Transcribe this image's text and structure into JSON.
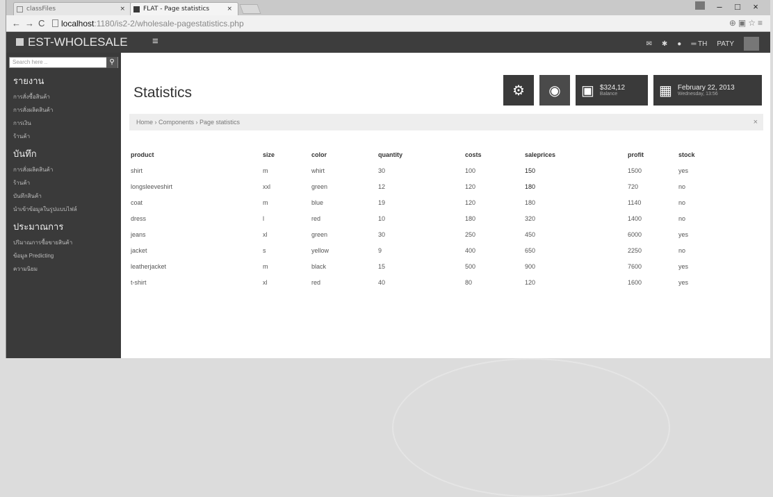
{
  "browser": {
    "tabs": [
      {
        "label": "classFiles",
        "close": "×"
      },
      {
        "label": "FLAT - Page statistics",
        "close": "×"
      }
    ],
    "url_host": "localhost",
    "url_path": ":1180/is2-2/wholesale-pagestatistics.php",
    "window_controls": [
      "–",
      "□",
      "×"
    ]
  },
  "app": {
    "brand": "EST-WHOLESALE",
    "lang": "TH",
    "user": "PATY"
  },
  "sidebar": {
    "search_placeholder": "Search here ..",
    "sections": [
      {
        "title": "รายงาน",
        "items": [
          "การสั่งซื้อสินค้า",
          "การสั่งผลิตสินค้า",
          "การเงิน",
          "ร้านค้า"
        ]
      },
      {
        "title": "บันทึก",
        "items": [
          "การสั่งผลิตสินค้า",
          "ร้านค้า",
          "บันทึกสินค้า",
          "นำเข้าข้อมูลในรูปแบบไฟล์"
        ]
      },
      {
        "title": "ประมาณการ",
        "items": [
          "ปริมาณการซื้อขายสินค้า",
          "ข้อมูล Predicting",
          "ความนิยม"
        ]
      }
    ]
  },
  "page": {
    "title": "Statistics",
    "breadcrumb": "Home › Components › Page statistics",
    "crumb_close": "×",
    "balance_amount": "$324,12",
    "balance_label": "Balance",
    "date_main": "February 22, 2013",
    "date_sub": "Wednesday, 13:56"
  },
  "table": {
    "headers": [
      "product",
      "size",
      "color",
      "quantity",
      "costs",
      "saleprices",
      "profit",
      "stock"
    ],
    "rows": [
      [
        "shirt",
        "m",
        "whirt",
        "30",
        "100",
        "150",
        "1500",
        "yes"
      ],
      [
        "longsleeveshirt",
        "xxl",
        "green",
        "12",
        "120",
        "180",
        "720",
        "no"
      ],
      [
        "coat",
        "m",
        "blue",
        "19",
        "120",
        "180",
        "1140",
        "no"
      ],
      [
        "dress",
        "l",
        "red",
        "10",
        "180",
        "320",
        "1400",
        "no"
      ],
      [
        "jeans",
        "xl",
        "green",
        "30",
        "250",
        "450",
        "6000",
        "yes"
      ],
      [
        "jacket",
        "s",
        "yellow",
        "9",
        "400",
        "650",
        "2250",
        "no"
      ],
      [
        "leatherjacket",
        "m",
        "black",
        "15",
        "500",
        "900",
        "7600",
        "yes"
      ],
      [
        "t-shirt",
        "xl",
        "red",
        "40",
        "80",
        "120",
        "1600",
        "yes"
      ]
    ]
  },
  "icons": [
    "gear-icon",
    "globe-icon",
    "money-icon",
    "calendar-icon",
    "search-icon",
    "menu-icon"
  ]
}
